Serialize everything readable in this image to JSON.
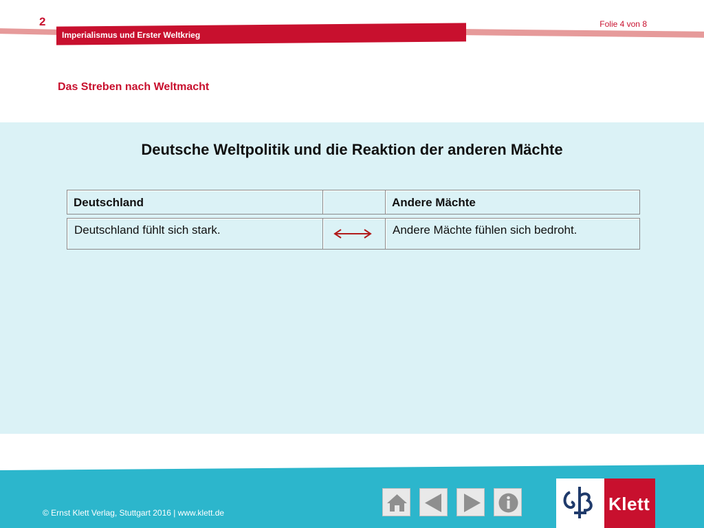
{
  "header": {
    "chapter_number": "2",
    "slide_counter": "Folie 4 von 8",
    "band_label": "Imperialismus und Erster Weltkrieg",
    "subtitle": "Das Streben nach Weltmacht",
    "accent_color": "#c8102e",
    "band_secondary_color": "#e69a9a"
  },
  "main": {
    "title": "Deutsche Weltpolitik und die Reaktion der anderen Mächte",
    "background_color": "#dbf2f6",
    "table": {
      "headers": [
        "Deutschland",
        "",
        "Andere Mächte"
      ],
      "rows": [
        {
          "left": "Deutschland fühlt sich stark.",
          "middle_icon": "double-arrow-icon",
          "right": "Andere Mächte fühlen sich bedroht."
        }
      ]
    }
  },
  "footer": {
    "copyright": "© Ernst Klett Verlag, Stuttgart 2016 | www.klett.de",
    "background_color": "#2cb6cc",
    "nav_buttons": [
      {
        "name": "home",
        "icon": "home-icon"
      },
      {
        "name": "previous",
        "icon": "triangle-left-icon"
      },
      {
        "name": "next",
        "icon": "triangle-right-icon"
      },
      {
        "name": "info",
        "icon": "info-icon"
      }
    ],
    "logo_text": "Klett"
  }
}
